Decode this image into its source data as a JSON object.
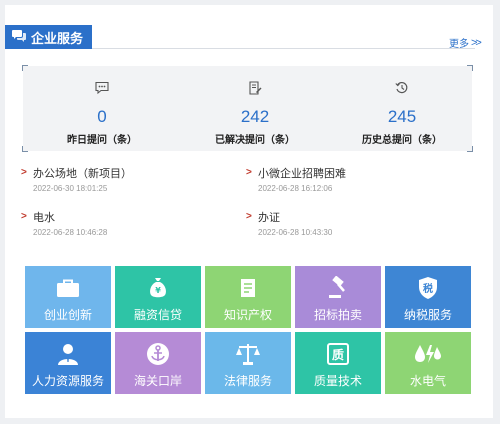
{
  "header": {
    "title": "企业服务",
    "more_label": "更多"
  },
  "stats": [
    {
      "value": "0",
      "label": "昨日提问（条）",
      "icon": "chat-icon"
    },
    {
      "value": "242",
      "label": "已解决提问（条）",
      "icon": "document-edit-icon"
    },
    {
      "value": "245",
      "label": "历史总提问（条）",
      "icon": "history-icon"
    }
  ],
  "news": [
    {
      "title": "办公场地（新项目）",
      "date": "2022-06-30 18:01:25"
    },
    {
      "title": "小微企业招聘困难",
      "date": "2022-06-28 16:12:06"
    },
    {
      "title": "电水",
      "date": "2022-06-28 10:46:28"
    },
    {
      "title": "办证",
      "date": "2022-06-28 10:43:30"
    }
  ],
  "services": [
    {
      "label": "创业创新",
      "icon": "briefcase-icon",
      "color": "#6fb6ec"
    },
    {
      "label": "融资信贷",
      "icon": "money-bag-icon",
      "color": "#2ec4a6"
    },
    {
      "label": "知识产权",
      "icon": "book-icon",
      "color": "#8ed574"
    },
    {
      "label": "招标拍卖",
      "icon": "gavel-icon",
      "color": "#a98bd8"
    },
    {
      "label": "纳税服务",
      "icon": "tax-shield-icon",
      "color": "#3e86d4"
    },
    {
      "label": "人力资源服务",
      "icon": "person-icon",
      "color": "#3b83d6"
    },
    {
      "label": "海关口岸",
      "icon": "anchor-icon",
      "color": "#b58bd6"
    },
    {
      "label": "法律服务",
      "icon": "scales-icon",
      "color": "#6bb8ea"
    },
    {
      "label": "质量技术",
      "icon": "quality-icon",
      "color": "#2ec4a6"
    },
    {
      "label": "水电气",
      "icon": "utilities-icon",
      "color": "#8ed574"
    }
  ],
  "colors": {
    "accent": "#2b70c9",
    "arrow": "#c0392b"
  }
}
